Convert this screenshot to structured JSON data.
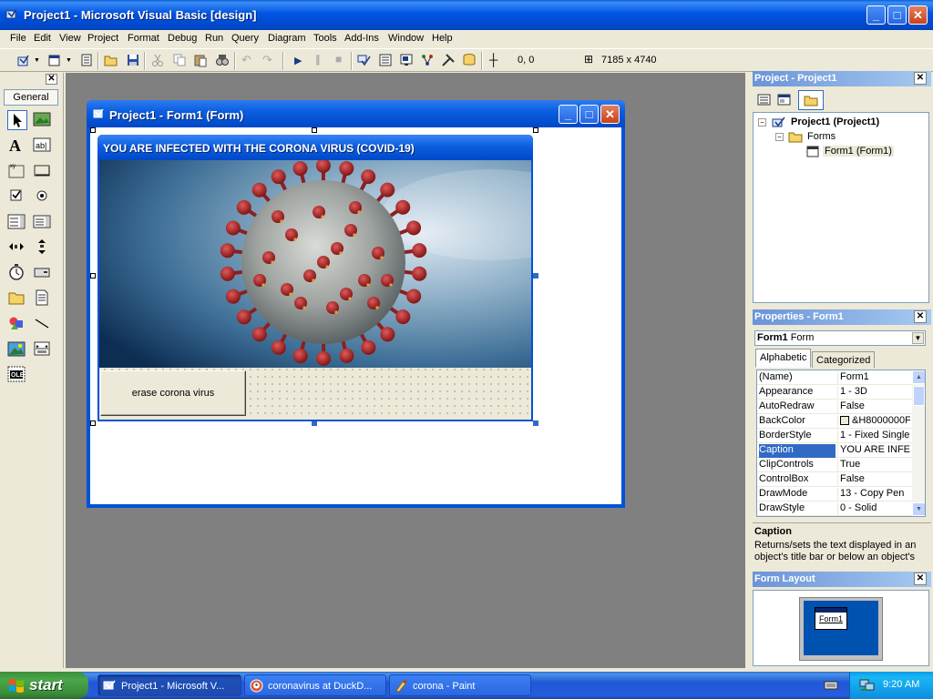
{
  "window": {
    "title": "Project1 - Microsoft Visual Basic [design]"
  },
  "menu": [
    "File",
    "Edit",
    "View",
    "Project",
    "Format",
    "Debug",
    "Run",
    "Query",
    "Diagram",
    "Tools",
    "Add-Ins",
    "Window",
    "Help"
  ],
  "toolbar": {
    "position": "0, 0",
    "size": "7185 x 4740"
  },
  "toolbox": {
    "tab": "General"
  },
  "form_window": {
    "title": "Project1 - Form1 (Form)"
  },
  "form": {
    "caption": "YOU ARE INFECTED WITH THE CORONA VIRUS (COVID-19)",
    "button_label": "erase corona virus"
  },
  "project_pane": {
    "title": "Project - Project1",
    "root": "Project1 (Project1)",
    "folder": "Forms",
    "item": "Form1 (Form1)"
  },
  "properties_pane": {
    "title": "Properties - Form1",
    "object_name": "Form1",
    "object_type": "Form",
    "tabs": [
      "Alphabetic",
      "Categorized"
    ],
    "rows": [
      {
        "name": "(Name)",
        "value": "Form1"
      },
      {
        "name": "Appearance",
        "value": "1 - 3D"
      },
      {
        "name": "AutoRedraw",
        "value": "False"
      },
      {
        "name": "BackColor",
        "value": "&H8000000F"
      },
      {
        "name": "BorderStyle",
        "value": "1 - Fixed Single"
      },
      {
        "name": "Caption",
        "value": "YOU ARE INFEC"
      },
      {
        "name": "ClipControls",
        "value": "True"
      },
      {
        "name": "ControlBox",
        "value": "False"
      },
      {
        "name": "DrawMode",
        "value": "13 - Copy Pen"
      },
      {
        "name": "DrawStyle",
        "value": "0 - Solid"
      }
    ],
    "selected_row": "Caption",
    "description_title": "Caption",
    "description_text": "Returns/sets the text displayed in an object's title bar or below an object's"
  },
  "layout_pane": {
    "title": "Form Layout",
    "form_label": "Form1"
  },
  "taskbar": {
    "start": "start",
    "items": [
      "Project1 - Microsoft V...",
      "coronavirus at DuckD...",
      "corona - Paint"
    ],
    "clock": "9:20 AM"
  },
  "colors": {
    "xp_blue": "#0054e3",
    "selection": "#316ac5",
    "mdi_bg": "#808080",
    "start_green": "#3c8f3c"
  }
}
